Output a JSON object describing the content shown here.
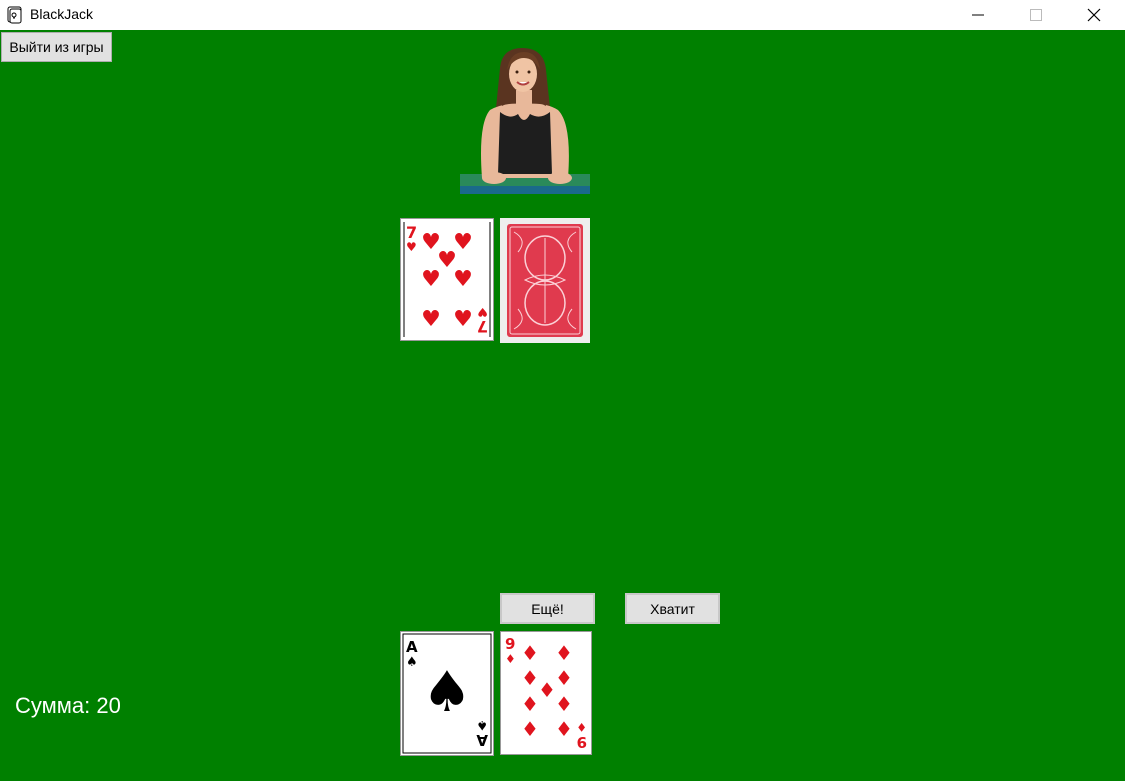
{
  "window": {
    "title": "BlackJack",
    "icon": "blackjack-app-icon",
    "controls": [
      "minimize-icon",
      "maximize-icon",
      "close-icon"
    ]
  },
  "table": {
    "felt_color": "#008000",
    "exit_button_label": "Выйти из игры"
  },
  "dealer": {
    "avatar": "dealer-woman-photo",
    "cards": [
      {
        "rank": "7",
        "suit": "hearts",
        "face_up": true
      },
      {
        "rank": "",
        "suit": "",
        "face_up": false
      }
    ]
  },
  "player": {
    "cards": [
      {
        "rank": "A",
        "suit": "spades",
        "face_up": true
      },
      {
        "rank": "9",
        "suit": "diamonds",
        "face_up": true
      }
    ],
    "sum_text": "Сумма: 20"
  },
  "actions": {
    "hit_label": "Ещё!",
    "stand_label": "Хватит"
  },
  "colors": {
    "red_suit": "#e0141e",
    "black_suit": "#000000",
    "card_back": "#e03a4e"
  }
}
